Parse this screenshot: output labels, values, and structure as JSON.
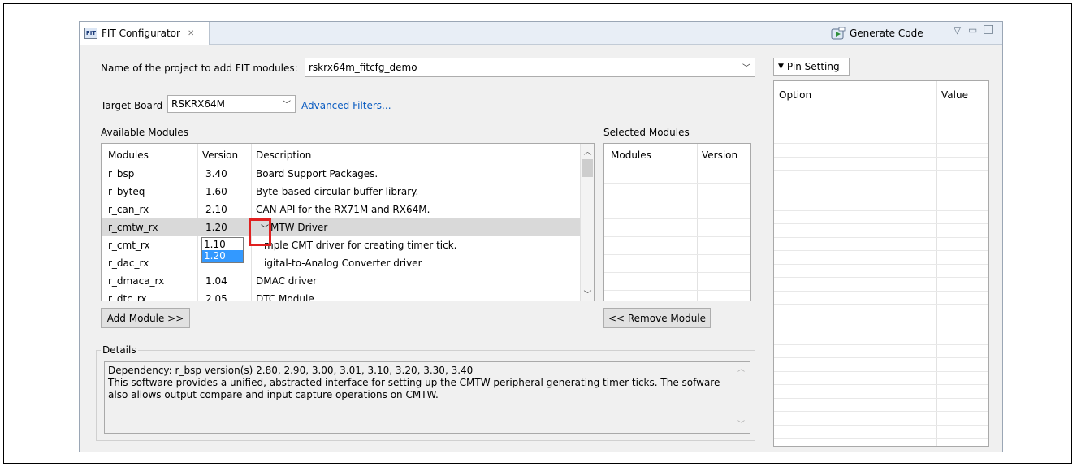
{
  "tab": {
    "title": "FIT Configurator",
    "icon_text": "FIT"
  },
  "toolbar": {
    "generate_label": "Generate Code"
  },
  "project": {
    "label": "Name of the project to add FIT modules:",
    "value": "rskrx64m_fitcfg_demo"
  },
  "board": {
    "label": "Target Board",
    "value": "RSKRX64M",
    "advanced_link": "Advanced Filters..."
  },
  "available": {
    "title": "Available Modules",
    "headers": {
      "module": "Modules",
      "version": "Version",
      "description": "Description"
    },
    "rows": [
      {
        "module": "r_bsp",
        "version": "3.40",
        "description": "Board Support Packages."
      },
      {
        "module": "r_byteq",
        "version": "1.60",
        "description": "Byte-based circular buffer library."
      },
      {
        "module": "r_can_rx",
        "version": "2.10",
        "description": "CAN API for the RX71M and RX64M."
      },
      {
        "module": "r_cmtw_rx",
        "version": "1.20",
        "description": "MTW Driver"
      },
      {
        "module": "r_cmt_rx",
        "version": "",
        "description": "mple CMT driver for creating timer tick."
      },
      {
        "module": "r_dac_rx",
        "version": "",
        "description": "igital-to-Analog Converter driver"
      },
      {
        "module": "r_dmaca_rx",
        "version": "1.04",
        "description": "DMAC driver"
      },
      {
        "module": "r_dtc_rx",
        "version": "2.05",
        "description": "DTC Module"
      }
    ],
    "dropdown_options": [
      "1.10",
      "1.20"
    ],
    "dropdown_selected": "1.20"
  },
  "selected": {
    "title": "Selected Modules",
    "headers": {
      "module": "Modules",
      "version": "Version"
    }
  },
  "buttons": {
    "add": "Add Module >>",
    "remove": "<< Remove Module"
  },
  "details": {
    "title": "Details",
    "lines": [
      "Dependency: r_bsp version(s) 2.80, 2.90, 3.00, 3.01, 3.10, 3.20, 3.30, 3.40",
      "This software provides a unified, abstracted interface for setting up the CMTW peripheral generating timer ticks.  The sofware",
      "also allows output compare and input capture operations on CMTW."
    ]
  },
  "pin": {
    "tab_label": "Pin Setting",
    "headers": {
      "option": "Option",
      "value": "Value"
    }
  },
  "colors": {
    "link": "#0b5cc1",
    "highlight": "#e02020",
    "selection": "#3399ff"
  },
  "icons": [
    "fit-configurator-icon",
    "close-icon",
    "generate-code-icon",
    "view-menu-icon",
    "minimize-icon",
    "maximize-icon",
    "chevron-down-icon",
    "triangle-down-icon"
  ]
}
